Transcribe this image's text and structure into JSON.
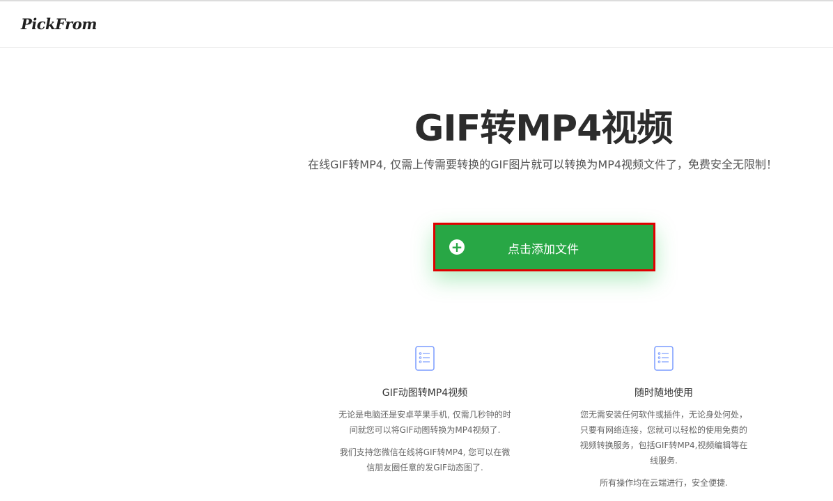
{
  "header": {
    "logo": "PickFrom"
  },
  "hero": {
    "title": "GIF转MP4视频",
    "subtitle": "在线GIF转MP4, 仅需上传需要转换的GIF图片就可以转换为MP4视频文件了，免费安全无限制！"
  },
  "upload": {
    "label": "点击添加文件",
    "icon": "plus-circle-icon",
    "color": "#28a745",
    "highlight_border": "#e00000"
  },
  "features": [
    {
      "icon": "document-list-icon",
      "title": "GIF动图转MP4视频",
      "paragraphs": [
        [
          "无论是电脑还是安卓苹果手机, 仅需几秒钟的时",
          "间就您可以将GIF动图转换为MP4视频了."
        ],
        [
          "我们支持您微信在线将GIF转MP4, 您可以在微",
          "信朋友圈任意的发GIF动态图了."
        ]
      ]
    },
    {
      "icon": "document-list-icon",
      "title": "随时随地使用",
      "paragraphs": [
        [
          "您无需安装任何软件或插件，无论身处何处，",
          "只要有网络连接，您就可以轻松的使用免费的",
          "视频转换服务，包括GIF转MP4,视频编辑等在",
          "线服务."
        ],
        [
          "所有操作均在云端进行，安全便捷."
        ]
      ]
    }
  ]
}
